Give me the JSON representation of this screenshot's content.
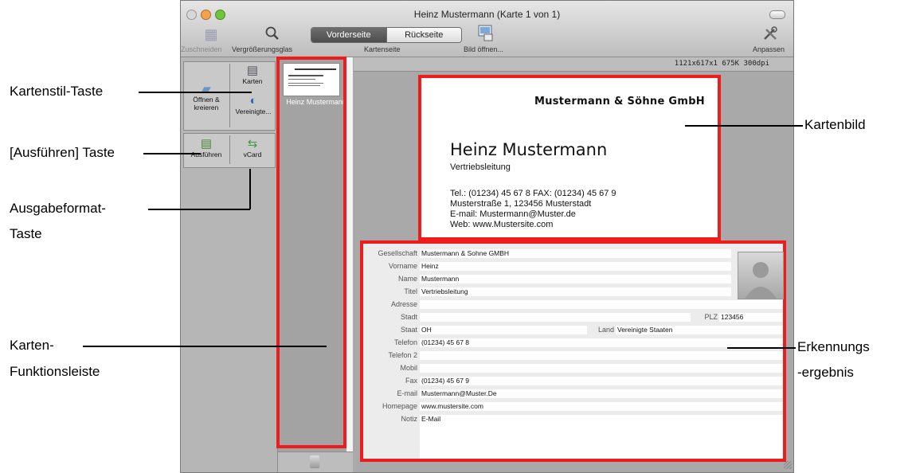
{
  "window": {
    "title": "Heinz Mustermann (Karte 1 von 1)",
    "traffic_colors": [
      "#d7d7d7",
      "#f2a24a",
      "#6fc43d"
    ]
  },
  "toolbar": {
    "crop_label": "Zuschneiden",
    "magnifier_label": "Vergrößerungsglas",
    "side_label": "Kartenseite",
    "front_label": "Vorderseite",
    "back_label": "Rückseite",
    "open_image_label": "Bild öffnen...",
    "customize_label": "Anpassen"
  },
  "left_panel": {
    "open_create": "Öffnen & kreieren",
    "cards": "Karten",
    "united": "Vereinigte...",
    "execute": "Ausführen",
    "vcard": "vCard"
  },
  "thumbnail": {
    "caption": "Heinz Mustermann"
  },
  "image_info": "1121x617x1  675K  300dpi",
  "card": {
    "company": "Mustermann & Söhne GmbH",
    "name": "Heinz Mustermann",
    "title": "Vertriebsleitung",
    "tel_fax": "Tel.: (01234) 45 67 8 FAX: (01234) 45 67 9",
    "address": "Musterstraße 1, 123456 Musterstadt",
    "email": "E-mail: Mustermann@Muster.de",
    "web": "Web: www.Mustersite.com"
  },
  "results": {
    "labels": {
      "company": "Gesellschaft",
      "first": "Vorname",
      "name": "Name",
      "title": "Titel",
      "address": "Adresse",
      "city": "Stadt",
      "zip": "PLZ",
      "state": "Staat",
      "country": "Land",
      "phone": "Telefon",
      "phone2": "Telefon 2",
      "mobile": "Mobil",
      "fax": "Fax",
      "email": "E-mail",
      "homepage": "Homepage",
      "note": "Notiz"
    },
    "values": {
      "company": "Mustermann & Sohne GMBH",
      "first": "Heinz",
      "name": "Mustermann",
      "title": "Vertriebsleitung",
      "address": "",
      "city": "",
      "zip": "123456",
      "state": "OH",
      "country": "Vereinigte Staaten",
      "phone": "(01234) 45 67 8",
      "phone2": "",
      "mobile": "",
      "fax": "(01234) 45 67 9",
      "email": "Mustermann@Muster.De",
      "homepage": "www.mustersite.com",
      "note": "E-Mail"
    }
  },
  "annotations": {
    "card_style_key": "Kartenstil-Taste",
    "execute_key": "[Ausführen] Taste",
    "output_format_1": "Ausgabeformat-",
    "output_format_2": "Taste",
    "function_bar_1": "Karten-",
    "function_bar_2": "Funktionsleiste",
    "card_image": "Kartenbild",
    "recognition_1": "Erkennungs",
    "recognition_2": "-ergebnis"
  },
  "colors": {
    "highlight": "#ee1c1c"
  }
}
